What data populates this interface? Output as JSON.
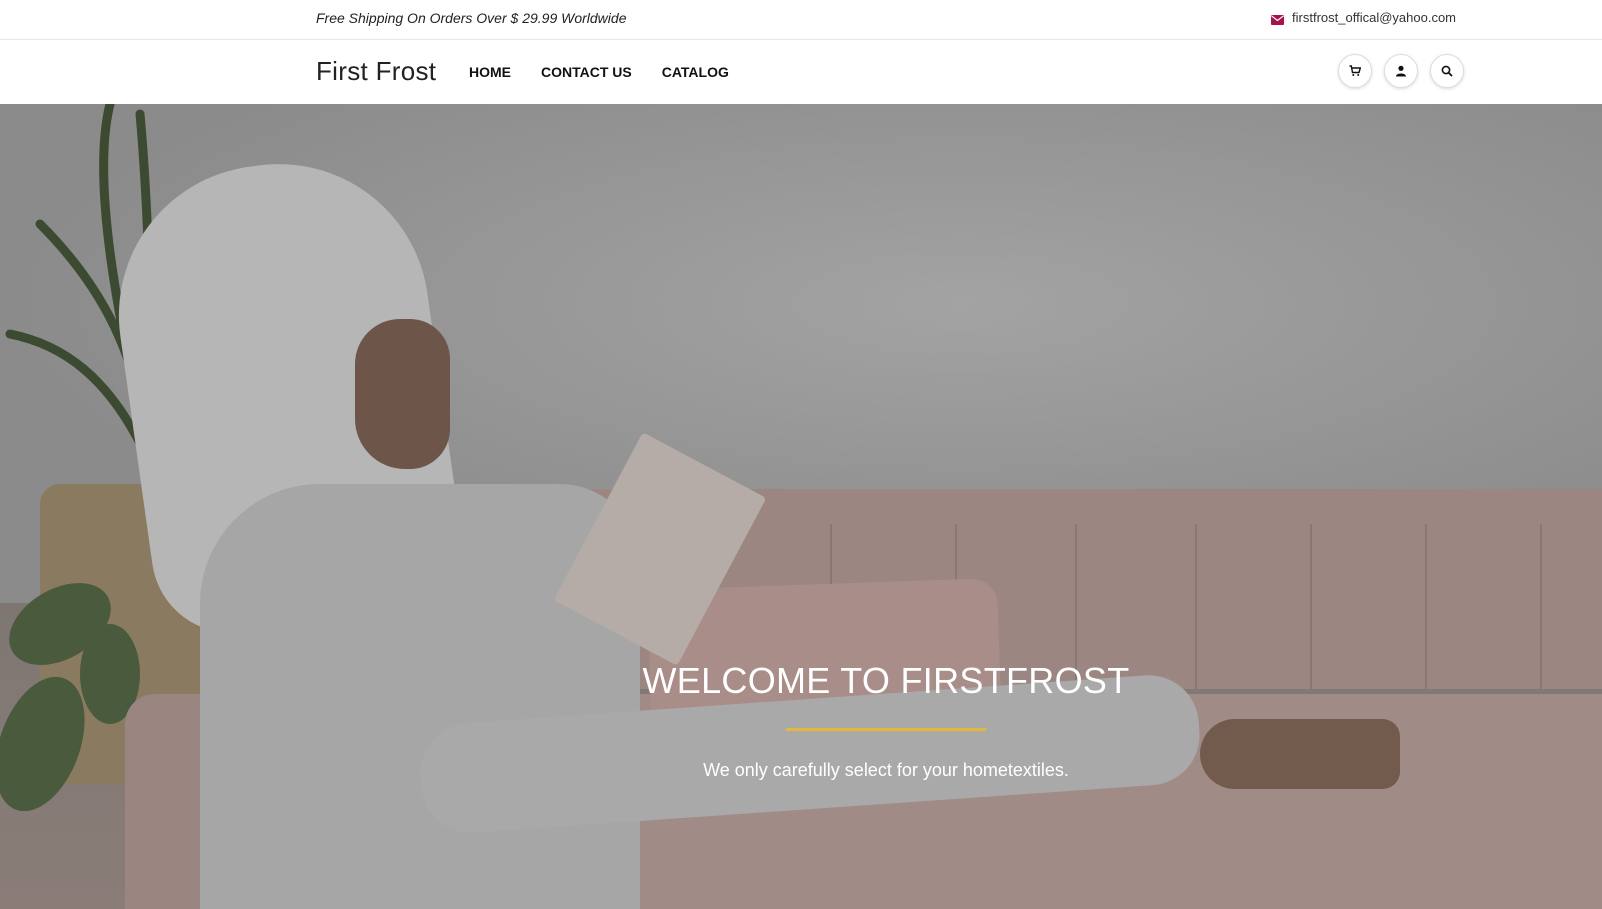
{
  "topbar": {
    "promo": "Free Shipping On Orders Over $ 29.99 Worldwide",
    "email": "firstfrost_offical@yahoo.com",
    "mail_icon": "envelope-icon",
    "mail_icon_color": "#a5124e"
  },
  "header": {
    "logo": "First Frost",
    "nav": [
      {
        "label": "HOME"
      },
      {
        "label": "CONTACT US"
      },
      {
        "label": "CATALOG"
      }
    ],
    "icons": [
      "cart-icon",
      "user-icon",
      "search-icon"
    ]
  },
  "hero": {
    "title": "WELCOME TO FIRSTFROST",
    "subtitle": "We only carefully select for your hometextiles.",
    "accent_color": "#e0b93a"
  }
}
